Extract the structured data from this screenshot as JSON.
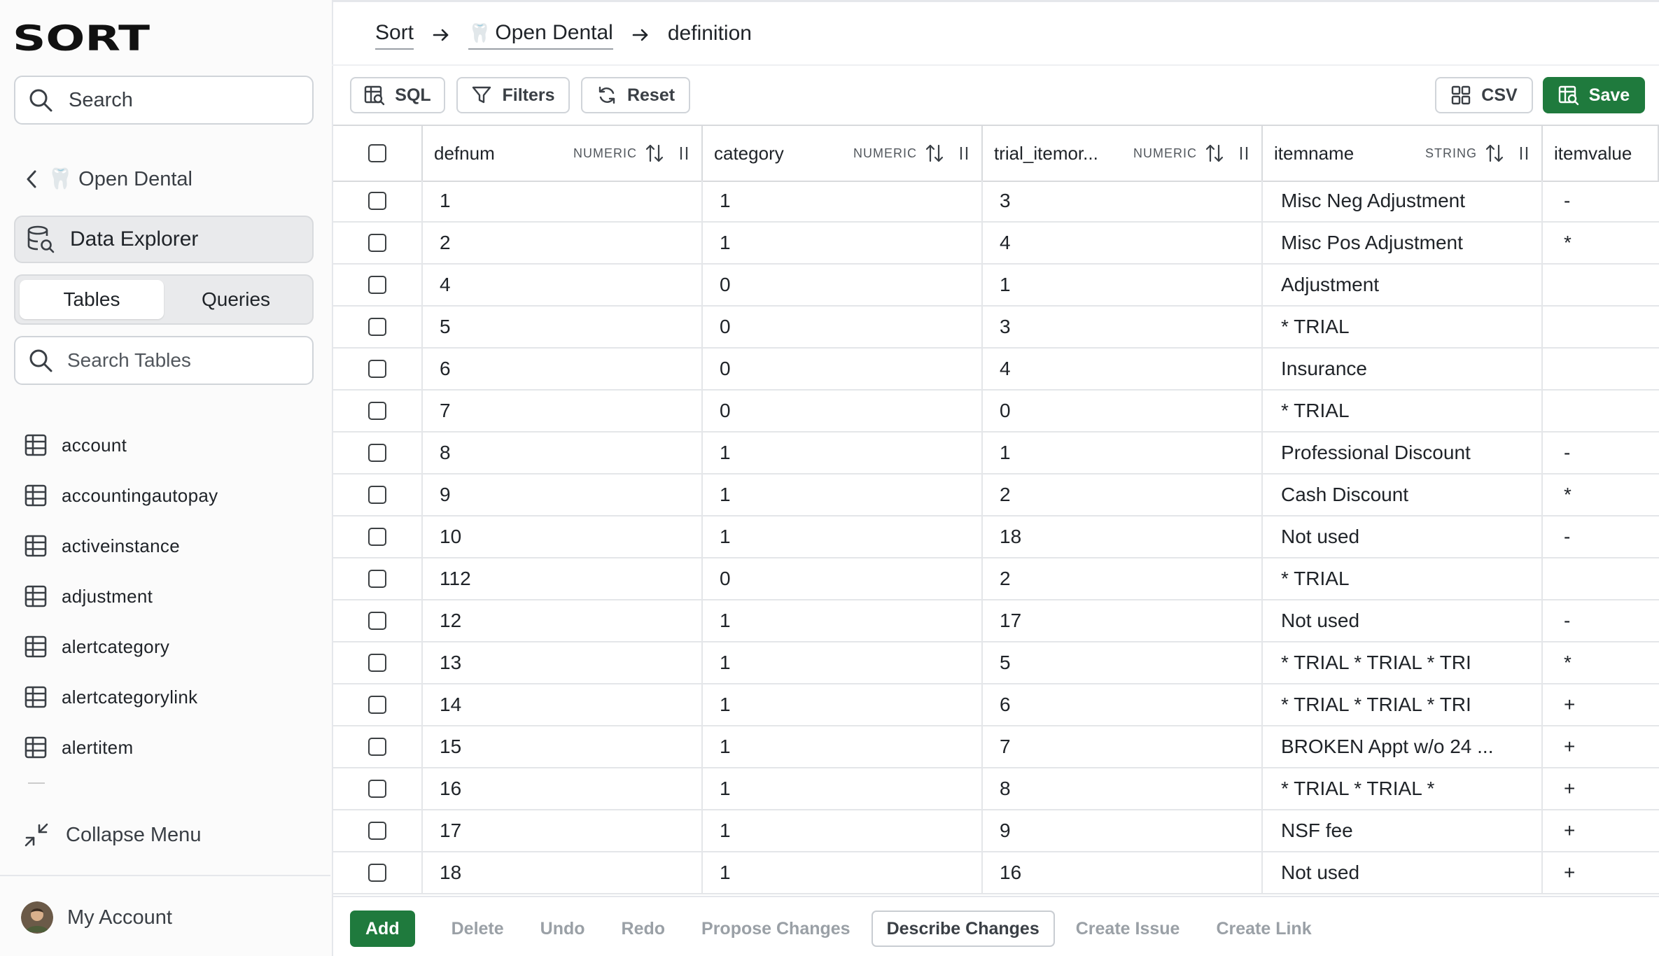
{
  "app": {
    "logo_text": "SORT"
  },
  "sidebar": {
    "search_label": "Search",
    "back_label": "🦷 Open Dental",
    "nav_active": "Data Explorer",
    "segments": [
      "Tables",
      "Queries"
    ],
    "active_segment": "Tables",
    "table_search_placeholder": "Search Tables",
    "tables": [
      "account",
      "accountingautopay",
      "activeinstance",
      "adjustment",
      "alertcategory",
      "alertcategorylink",
      "alertitem"
    ],
    "collapse_label": "Collapse Menu",
    "account_label": "My Account"
  },
  "breadcrumb": {
    "root": "Sort",
    "db_icon": "🦷",
    "db": "Open Dental",
    "table": "definition"
  },
  "toolbar": {
    "sql": "SQL",
    "filters": "Filters",
    "reset": "Reset",
    "csv": "CSV",
    "save": "Save"
  },
  "columns": [
    {
      "name": "defnum",
      "type": "NUMERIC"
    },
    {
      "name": "category",
      "type": "NUMERIC"
    },
    {
      "name": "trial_itemor...",
      "type": "NUMERIC"
    },
    {
      "name": "itemname",
      "type": "STRING"
    },
    {
      "name": "itemvalue",
      "type": ""
    }
  ],
  "rows": [
    [
      "1",
      "1",
      "3",
      "Misc Neg Adjustment",
      "-"
    ],
    [
      "2",
      "1",
      "4",
      "Misc Pos Adjustment",
      "*"
    ],
    [
      "4",
      "0",
      "1",
      "Adjustment",
      ""
    ],
    [
      "5",
      "0",
      "3",
      "* TRIAL",
      ""
    ],
    [
      "6",
      "0",
      "4",
      "Insurance",
      ""
    ],
    [
      "7",
      "0",
      "0",
      "* TRIAL",
      ""
    ],
    [
      "8",
      "1",
      "1",
      "Professional Discount",
      "-"
    ],
    [
      "9",
      "1",
      "2",
      "Cash Discount",
      "*"
    ],
    [
      "10",
      "1",
      "18",
      "Not used",
      "-"
    ],
    [
      "112",
      "0",
      "2",
      "* TRIAL",
      ""
    ],
    [
      "12",
      "1",
      "17",
      "Not used",
      "-"
    ],
    [
      "13",
      "1",
      "5",
      "* TRIAL * TRIAL * TRI",
      "*"
    ],
    [
      "14",
      "1",
      "6",
      "* TRIAL * TRIAL * TRI",
      "+"
    ],
    [
      "15",
      "1",
      "7",
      "BROKEN Appt w/o 24 ...",
      "+"
    ],
    [
      "16",
      "1",
      "8",
      "* TRIAL * TRIAL *",
      "+"
    ],
    [
      "17",
      "1",
      "9",
      "NSF fee",
      "+"
    ],
    [
      "18",
      "1",
      "16",
      "Not used",
      "+"
    ]
  ],
  "bottom_actions": {
    "add": "Add",
    "delete": "Delete",
    "undo": "Undo",
    "redo": "Redo",
    "propose": "Propose Changes",
    "describe": "Describe Changes",
    "create_issue": "Create Issue",
    "create_link": "Create Link"
  },
  "colors": {
    "accent_green": "#1f7a3d",
    "border": "#d0d4d9"
  }
}
